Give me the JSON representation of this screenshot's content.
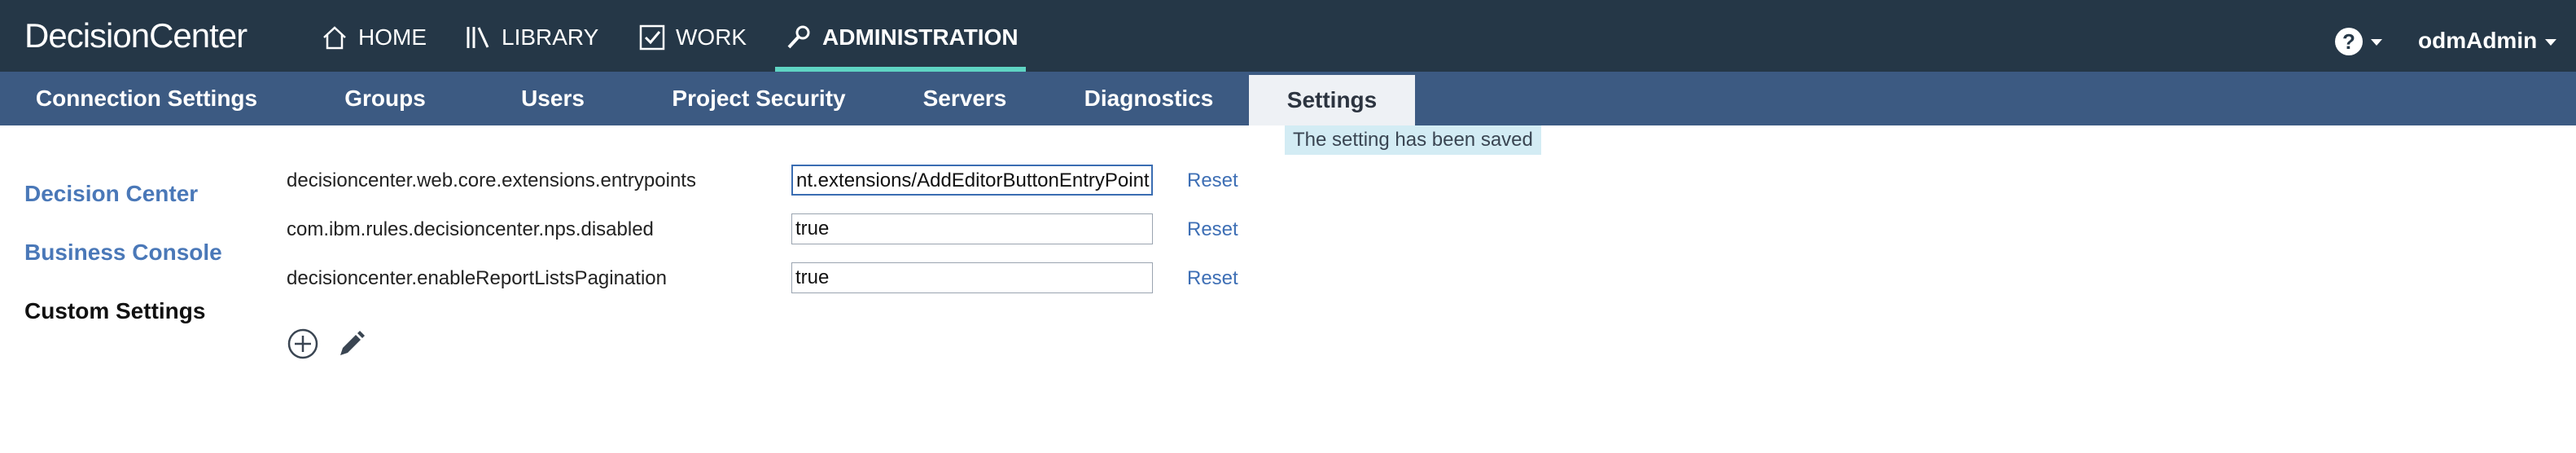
{
  "header": {
    "brand": "DecisionCenter",
    "nav": [
      {
        "label": "HOME",
        "icon": "home-icon"
      },
      {
        "label": "LIBRARY",
        "icon": "library-icon"
      },
      {
        "label": "WORK",
        "icon": "check-icon"
      },
      {
        "label": "ADMINISTRATION",
        "icon": "wrench-icon",
        "active": true
      }
    ],
    "help_label": "?",
    "user_name": "odmAdmin"
  },
  "subnav": {
    "tabs": [
      {
        "label": "Connection Settings"
      },
      {
        "label": "Groups"
      },
      {
        "label": "Users"
      },
      {
        "label": "Project Security"
      },
      {
        "label": "Servers"
      },
      {
        "label": "Diagnostics"
      },
      {
        "label": "Settings",
        "active": true
      }
    ],
    "status_message": "The setting has been saved"
  },
  "sidebar": {
    "items": [
      {
        "label": "Decision Center"
      },
      {
        "label": "Business Console"
      },
      {
        "label": "Custom Settings",
        "active": true
      }
    ]
  },
  "settings": {
    "rows": [
      {
        "key": "decisioncenter.web.core.extensions.entrypoints",
        "value": "nt.extensions/AddEditorButtonEntryPoint",
        "reset_label": "Reset"
      },
      {
        "key": "com.ibm.rules.decisioncenter.nps.disabled",
        "value": "true",
        "reset_label": "Reset"
      },
      {
        "key": "decisioncenter.enableReportListsPagination",
        "value": "true",
        "reset_label": "Reset"
      }
    ],
    "add_icon": "plus-circle-icon",
    "edit_icon": "pencil-icon"
  },
  "colors": {
    "topbar": "#253747",
    "subbar": "#3c5a82",
    "accent_underline": "#5fd4c4",
    "link": "#4a78b8"
  }
}
